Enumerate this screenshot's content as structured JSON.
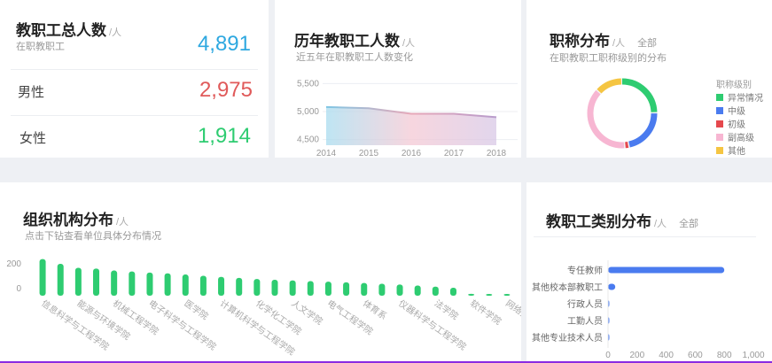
{
  "total": {
    "title": "教职工总人数",
    "unit": "/人",
    "subtitle": "在职教职工",
    "value": "4,891",
    "male_label": "男性",
    "male_value": "2,975",
    "female_label": "女性",
    "female_value": "1,914"
  },
  "history": {
    "title": "历年教职工人数",
    "unit": "/人",
    "subtitle": "近五年在职教职工人数变化"
  },
  "rank": {
    "title": "职称分布",
    "unit": "/人",
    "filter": "全部",
    "subtitle": "在职教职工职称级别的分布",
    "legend_title": "职称级别",
    "legend": [
      {
        "label": "异常情况",
        "color": "#2ecc71"
      },
      {
        "label": "中级",
        "color": "#4a7bef"
      },
      {
        "label": "初级",
        "color": "#e5484d"
      },
      {
        "label": "副高级",
        "color": "#f7b6d2"
      },
      {
        "label": "其他",
        "color": "#f5c542"
      }
    ]
  },
  "org": {
    "title": "组织机构分布",
    "unit": "/人",
    "subtitle": "点击下钻查看单位具体分布情况"
  },
  "category": {
    "title": "教职工类别分布",
    "unit": "/人",
    "filter": "全部"
  },
  "chart_data": [
    {
      "type": "area",
      "x": [
        "2014",
        "2015",
        "2016",
        "2017",
        "2018"
      ],
      "values": [
        5080,
        5060,
        4960,
        4960,
        4900
      ],
      "ylim": [
        4400,
        5600
      ],
      "yticks": [
        "5,500",
        "5,000",
        "4,500"
      ],
      "grid": true
    },
    {
      "type": "pie",
      "categories": [
        "异常情况",
        "中级",
        "初级",
        "副高级",
        "其他"
      ],
      "values": [
        25,
        22,
        2,
        38,
        13
      ]
    },
    {
      "type": "bar",
      "categories": [
        "信息科学与工程学院",
        "",
        "能源与环境学院",
        "",
        "机械工程学院",
        "",
        "电子科学与工程学院",
        "",
        "医学院",
        "",
        "计算机科学与工程学院",
        "",
        "化学化工学院",
        "",
        "人文学院",
        "",
        "电气工程学院",
        "",
        "体育系",
        "",
        "仪器科学与工程学院",
        "",
        "法学院",
        "",
        "软件学院",
        "",
        "网络空间"
      ],
      "values": [
        230,
        200,
        175,
        170,
        158,
        152,
        145,
        140,
        133,
        125,
        118,
        112,
        105,
        100,
        96,
        92,
        88,
        84,
        80,
        75,
        70,
        64,
        57,
        50,
        12,
        8,
        5
      ],
      "ylim": [
        -100,
        250
      ],
      "yticks": [
        "200",
        "0"
      ]
    },
    {
      "type": "bar",
      "orientation": "horizontal",
      "categories": [
        "专任教师",
        "其他校本部教职工",
        "行政人员",
        "工勤人员",
        "其他专业技术人员"
      ],
      "values": [
        800,
        50,
        5,
        5,
        5
      ],
      "xlim": [
        0,
        1000
      ],
      "xticks": [
        "0",
        "200",
        "400",
        "600",
        "800",
        "1,000"
      ]
    }
  ]
}
